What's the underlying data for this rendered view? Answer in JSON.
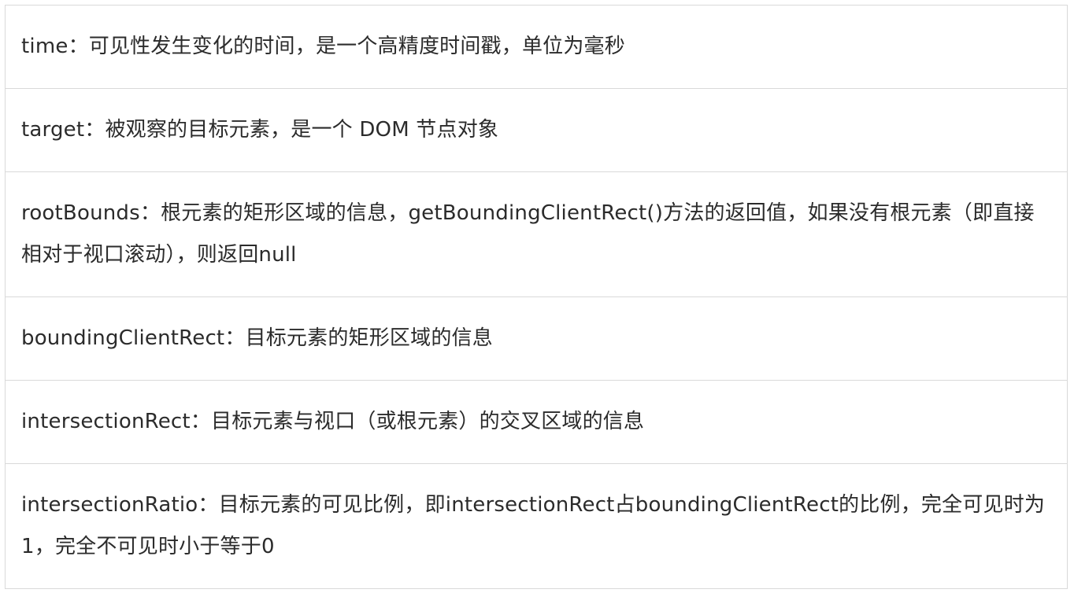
{
  "rows": [
    {
      "id": "time",
      "text": "time：可见性发生变化的时间，是一个高精度时间戳，单位为毫秒"
    },
    {
      "id": "target",
      "text": "target：被观察的目标元素，是一个 DOM 节点对象"
    },
    {
      "id": "rootBounds",
      "text": "rootBounds：根元素的矩形区域的信息，getBoundingClientRect()方法的返回值，如果没有根元素（即直接相对于视口滚动），则返回null"
    },
    {
      "id": "boundingClientRect",
      "text": "boundingClientRect：目标元素的矩形区域的信息"
    },
    {
      "id": "intersectionRect",
      "text": "intersectionRect：目标元素与视口（或根元素）的交叉区域的信息"
    },
    {
      "id": "intersectionRatio",
      "text": "intersectionRatio：目标元素的可见比例，即intersectionRect占boundingClientRect的比例，完全可见时为1，完全不可见时小于等于0"
    }
  ]
}
